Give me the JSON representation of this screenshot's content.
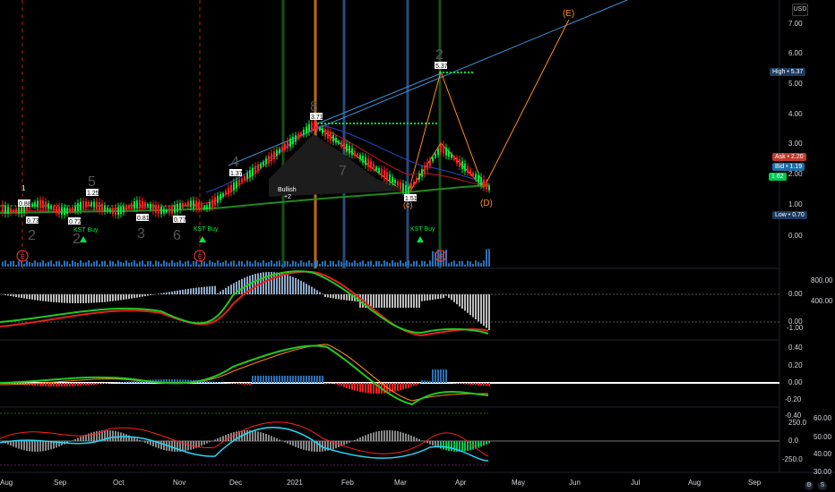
{
  "currency": "USD",
  "price_axis": {
    "ticks": [
      "7.00",
      "6.00",
      "5.00",
      "4.00",
      "3.00",
      "2.00",
      "1.00",
      "0.00"
    ],
    "high": {
      "label": "High",
      "value": "5.37"
    },
    "ask": {
      "label": "Ask",
      "value": "2.20"
    },
    "bid": {
      "label": "Bid",
      "value": "1.19"
    },
    "last": {
      "label": "",
      "value": "1.62"
    },
    "low": {
      "label": "Low",
      "value": "0.70"
    }
  },
  "pane2_axis": {
    "left": [
      "0.00",
      "0.00",
      "-1.00"
    ],
    "right": [
      "800.00",
      "400.00",
      "0.00"
    ]
  },
  "pane3_axis": [
    "0.40",
    "0.20",
    "0.00",
    "-0.20",
    "-0.40"
  ],
  "pane4_axis": {
    "left": [
      "250.0",
      "0.0",
      "-250.0"
    ],
    "right": [
      "60.00",
      "50.00",
      "40.00",
      "30.00"
    ]
  },
  "time_axis": [
    "Aug",
    "Sep",
    "Oct",
    "Nov",
    "Dec",
    "2021",
    "Feb",
    "Mar",
    "Apr",
    "May",
    "Jun",
    "Jul",
    "Aug",
    "Sep"
  ],
  "price_labels": [
    "0.88",
    "0.73",
    "0.72",
    "1.25",
    "0.81",
    "0.77",
    "1.37",
    "3.71",
    "1.51",
    "5.37"
  ],
  "wave_labels": {
    "w1": "1",
    "w2": "2",
    "w3": "3",
    "w4": "4",
    "w5": "5",
    "w6": "6",
    "w7": "7",
    "w8": "8",
    "E_top": "(E)",
    "D": "(D)",
    "paren_c": "(c)",
    "top2": "2"
  },
  "annotations": {
    "kst1": "KST Buy",
    "kst2": "KST Buy",
    "kst3": "KST Buy",
    "bullish": "Bullish",
    "bullish_sub": "+2",
    "e_marker": "E"
  },
  "bottom_buttons": [
    "⚙",
    "S"
  ],
  "colors": {
    "up": "#26a69a",
    "down": "#ef5350",
    "green_bright": "#00e640",
    "red": "#ff2020",
    "blue_line": "#3f8fd6",
    "orange": "#ff8c1a",
    "trend": "#2196f3"
  }
}
